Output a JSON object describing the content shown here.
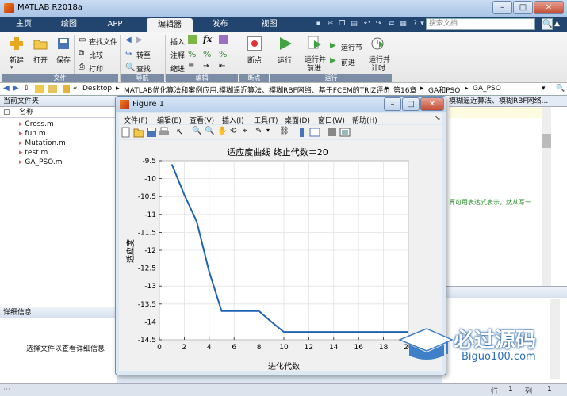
{
  "app": {
    "title": "MATLAB R2018a"
  },
  "window": {
    "min": "–",
    "max": "□",
    "close": "✕"
  },
  "tabs": [
    "主页",
    "绘图",
    "APP",
    "编辑器",
    "发布",
    "视图"
  ],
  "search": {
    "placeholder": "搜索文档"
  },
  "ribbon": {
    "new": "新建",
    "open": "打开",
    "save": "保存",
    "find_files": "查找文件",
    "compare": "比较",
    "print": "打印",
    "insert": "插入",
    "comment": "注释",
    "indent": "缩进",
    "goto": "转至",
    "find": "查找",
    "breakpoint": "断点",
    "run": "运行",
    "run_advance_l1": "运行并",
    "run_advance_l2": "前进",
    "run_section": "运行节",
    "advance": "前进",
    "run_time_l1": "运行并",
    "run_time_l2": "计时",
    "fx": "fx",
    "groups": {
      "file": "文件",
      "navigate": "导航",
      "edit": "编辑",
      "breakpoints": "断点",
      "run": "运行"
    }
  },
  "address": {
    "path": [
      "Desktop",
      "MATLAB优化算法和案例应用,模糊逼近算法、模糊RBF网络、基于FCEM的TRIZ评价",
      "第16章",
      "GA和PSO",
      "GA_PSO"
    ]
  },
  "current_folder": {
    "title": "当前文件夹",
    "col_name": "名称",
    "files": [
      "Cross.m",
      "fun.m",
      "Mutation.m",
      "test.m",
      "GA_PSO.m"
    ]
  },
  "details": {
    "title": "详细信息",
    "message": "选择文件以查看详细信息"
  },
  "editor": {
    "partial_tab": "模糊逼近算法、模糊RBF网络...",
    "comment_snip": "算可用表达式表示，然从写一"
  },
  "status": {
    "row_label": "行",
    "row": "1",
    "col_label": "列",
    "col": "1"
  },
  "figure": {
    "title": "Figure 1",
    "menus": [
      "文件(F)",
      "编辑(E)",
      "查看(V)",
      "插入(I)",
      "工具(T)",
      "桌面(D)",
      "窗口(W)",
      "帮助(H)"
    ]
  },
  "watermark": {
    "brand": "必过源码",
    "url": "Biguo100.com"
  },
  "chart_data": {
    "type": "line",
    "title": "适应度曲线  终止代数＝20",
    "xlabel": "进化代数",
    "ylabel": "适应度",
    "xlim": [
      0,
      20
    ],
    "ylim": [
      -14.5,
      -9.5
    ],
    "xticks": [
      0,
      2,
      4,
      6,
      8,
      10,
      12,
      14,
      16,
      18,
      20
    ],
    "yticks": [
      -9.5,
      -10,
      -10.5,
      -11,
      -11.5,
      -12,
      -12.5,
      -13,
      -13.5,
      -14,
      -14.5
    ],
    "grid": true,
    "color": "#1f63b5",
    "x": [
      1,
      2,
      3,
      4,
      5,
      6,
      7,
      8,
      9,
      10,
      11,
      12,
      13,
      14,
      15,
      16,
      17,
      18,
      19,
      20
    ],
    "y": [
      -9.6,
      -10.45,
      -11.2,
      -12.6,
      -13.7,
      -13.7,
      -13.7,
      -13.7,
      -14.0,
      -14.28,
      -14.28,
      -14.28,
      -14.28,
      -14.28,
      -14.28,
      -14.28,
      -14.28,
      -14.28,
      -14.28,
      -14.28
    ]
  }
}
